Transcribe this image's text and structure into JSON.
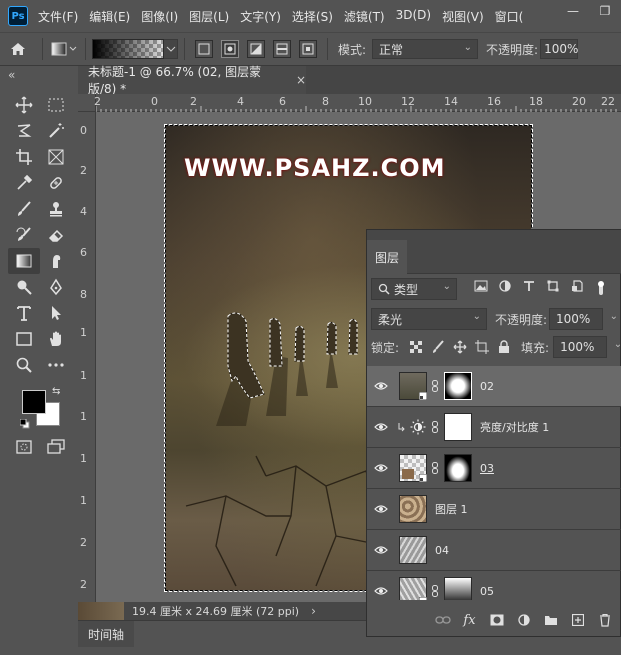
{
  "app": {
    "logo": "Ps"
  },
  "menu": [
    "文件(F)",
    "编辑(E)",
    "图像(I)",
    "图层(L)",
    "文字(Y)",
    "选择(S)",
    "滤镜(T)",
    "3D(D)",
    "视图(V)",
    "窗口("
  ],
  "window_controls": {
    "minimize": "—",
    "restore": "❐"
  },
  "options": {
    "mode_label": "模式:",
    "mode_value": "正常",
    "opacity_label": "不透明度:",
    "opacity_value": "100%"
  },
  "document": {
    "tab_title": "未标题-1 @ 66.7% (02, 图层蒙版/8) *",
    "close": "×",
    "watermark": "WWW.PSAHZ.COM",
    "status_text": "19.4 厘米 x 24.69 厘米 (72 ppi)",
    "status_arrow": "›"
  },
  "ruler": {
    "top": [
      "2",
      "0",
      "2",
      "4",
      "6",
      "8",
      "10",
      "12",
      "14",
      "16",
      "18",
      "20",
      "22"
    ],
    "left": [
      "0",
      "2",
      "4",
      "6",
      "8",
      "1",
      "1",
      "1",
      "1",
      "1",
      "2",
      "2"
    ]
  },
  "timeline": {
    "tab": "时间轴"
  },
  "left_collapse": "«",
  "layers": {
    "tab": "图层",
    "filter_value": "类型",
    "blend_value": "柔光",
    "opacity_label": "不透明度:",
    "opacity_value": "100%",
    "lock_label": "锁定:",
    "fill_label": "填充:",
    "fill_value": "100%",
    "items": [
      {
        "name": "02",
        "selected": true
      },
      {
        "name": "亮度/对比度 1",
        "selected": false
      },
      {
        "name": "03",
        "selected": false
      },
      {
        "name": "图层 1",
        "selected": false
      },
      {
        "name": "04",
        "selected": false
      },
      {
        "name": "05",
        "selected": false
      }
    ],
    "fx_label": "fx"
  }
}
